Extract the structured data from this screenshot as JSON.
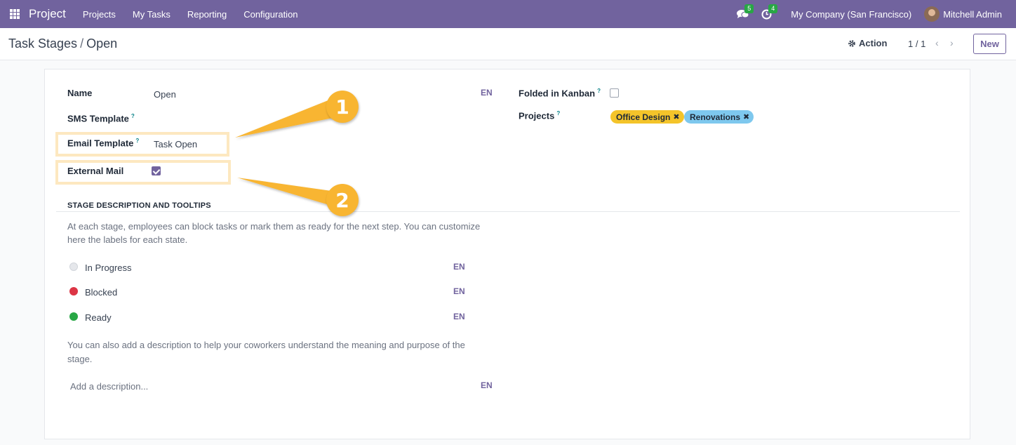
{
  "navbar": {
    "brand": "Project",
    "menu": [
      "Projects",
      "My Tasks",
      "Reporting",
      "Configuration"
    ],
    "messages_count": "5",
    "activities_count": "4",
    "company": "My Company (San Francisco)",
    "user": "Mitchell Admin",
    "color": "#71639e"
  },
  "control_panel": {
    "breadcrumb_parent": "Task Stages",
    "breadcrumb_sep": "/",
    "breadcrumb_current": "Open",
    "action_label": "Action",
    "pager": "1 / 1",
    "new_label": "New"
  },
  "form": {
    "name_label": "Name",
    "name_value": "Open",
    "sms_template_label": "SMS Template",
    "email_template_label": "Email Template",
    "email_template_value": "Task Open",
    "external_mail_label": "External Mail",
    "external_mail_checked": true,
    "folded_label": "Folded in Kanban",
    "folded_checked": false,
    "projects_label": "Projects",
    "projects": [
      {
        "name": "Office Design",
        "color": "#f4c42a"
      },
      {
        "name": "Renovations",
        "color": "#7ec8ee"
      }
    ],
    "lang": "EN",
    "tooltip_mark": "?"
  },
  "stage_section": {
    "title": "STAGE DESCRIPTION AND TOOLTIPS",
    "intro_line1": "At each stage, employees can block tasks or mark them as ready for the next step. You can customize",
    "intro_line2": "here the labels for each state.",
    "states": [
      {
        "label": "In Progress",
        "color": "#e5e7eb"
      },
      {
        "label": "Blocked",
        "color": "#dc3545"
      },
      {
        "label": "Ready",
        "color": "#28a745"
      }
    ],
    "desc_line1": "You can also add a description to help your coworkers understand the meaning and purpose of the",
    "desc_line2": "stage.",
    "desc_placeholder": "Add a description..."
  },
  "callouts": [
    "1",
    "2"
  ]
}
